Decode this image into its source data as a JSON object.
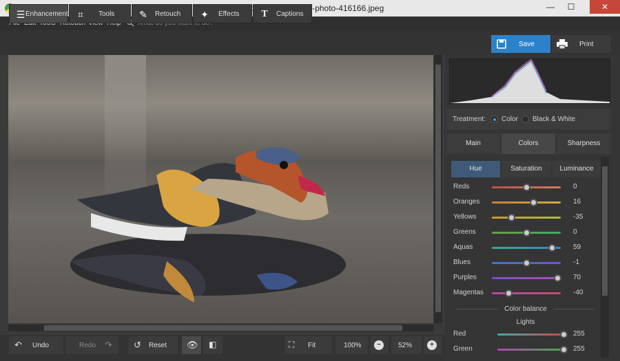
{
  "app": {
    "title": "PhotoWorks - pexels-photo-416166.jpeg",
    "min": "—",
    "max": "☐",
    "close": "✕"
  },
  "menu": {
    "file": "File",
    "edit": "Edit",
    "tools": "Tools",
    "retouch": "Retouch",
    "view": "View",
    "help": "Help",
    "search_placeholder": "What do you want to do?"
  },
  "tabs": {
    "enhancement": "Enhancement",
    "tools": "Tools",
    "retouch": "Retouch",
    "effects": "Effects",
    "captions": "Captions"
  },
  "actions": {
    "save": "Save",
    "print": "Print"
  },
  "treatment": {
    "label": "Treatment:",
    "color": "Color",
    "bw": "Black & White",
    "selected": "Color"
  },
  "panel_tabs": {
    "main": "Main",
    "colors": "Colors",
    "sharpness": "Sharpness",
    "active": "Colors"
  },
  "sub_tabs": {
    "hue": "Hue",
    "saturation": "Saturation",
    "luminance": "Luminance",
    "active": "Hue"
  },
  "hue_rows": [
    {
      "name": "Reds",
      "value": "0",
      "pos": 0.5,
      "c1": "#c0504d",
      "c2": "#d07a5a"
    },
    {
      "name": "Oranges",
      "value": "16",
      "pos": 0.6,
      "c1": "#d07a3a",
      "c2": "#d0b040"
    },
    {
      "name": "Yellows",
      "value": "-35",
      "pos": 0.28,
      "c1": "#c89a30",
      "c2": "#a8c040"
    },
    {
      "name": "Greens",
      "value": "0",
      "pos": 0.5,
      "c1": "#6aa040",
      "c2": "#40a870"
    },
    {
      "name": "Aquas",
      "value": "59",
      "pos": 0.87,
      "c1": "#3aa890",
      "c2": "#3a88c8"
    },
    {
      "name": "Blues",
      "value": "-1",
      "pos": 0.5,
      "c1": "#3a7ac8",
      "c2": "#6a58c8"
    },
    {
      "name": "Purples",
      "value": "70",
      "pos": 0.95,
      "c1": "#7a50c8",
      "c2": "#b050c0"
    },
    {
      "name": "Magentas",
      "value": "-40",
      "pos": 0.24,
      "c1": "#b848a8",
      "c2": "#c84a70"
    }
  ],
  "color_balance": {
    "title": "Color balance",
    "lights": "Lights",
    "rows": [
      {
        "name": "Red",
        "value": "255",
        "pos": 0.96,
        "c1": "#4aa8a8",
        "c2": "#c84848"
      },
      {
        "name": "Green",
        "value": "255",
        "pos": 0.96,
        "c1": "#b048b0",
        "c2": "#48a848"
      }
    ]
  },
  "bottom": {
    "undo": "Undo",
    "redo": "Redo",
    "reset": "Reset",
    "fit": "Fit",
    "zoom100": "100%",
    "zoom": "52%"
  }
}
